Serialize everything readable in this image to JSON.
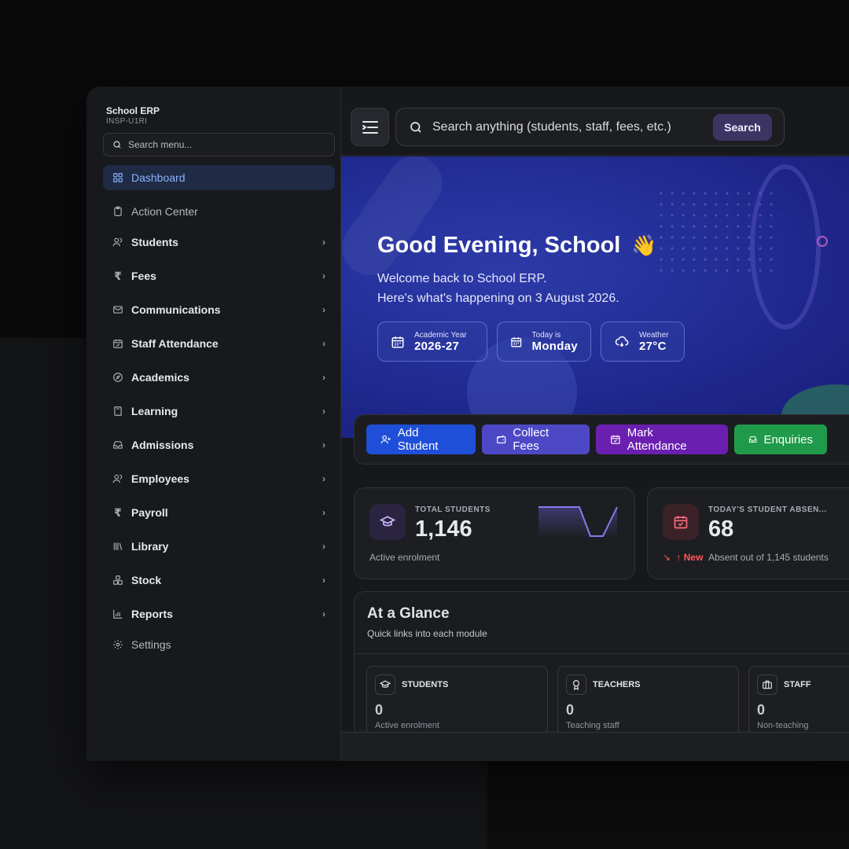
{
  "brand": {
    "title": "School ERP",
    "code": "INSP-U1RI"
  },
  "sidebar": {
    "search_placeholder": "Search menu...",
    "items": [
      {
        "label": "Dashboard",
        "icon": "grid-icon",
        "active": true
      },
      {
        "label": "Action Center",
        "icon": "clipboard-icon"
      },
      {
        "label": "Students",
        "icon": "users-icon"
      },
      {
        "label": "Fees",
        "icon": "rupee-icon"
      },
      {
        "label": "Communications",
        "icon": "mail-icon"
      },
      {
        "label": "Staff Attendance",
        "icon": "calendar-check-icon"
      },
      {
        "label": "Academics",
        "icon": "compass-icon"
      },
      {
        "label": "Learning",
        "icon": "book-icon"
      },
      {
        "label": "Admissions",
        "icon": "inbox-icon"
      },
      {
        "label": "Employees",
        "icon": "users-icon"
      },
      {
        "label": "Payroll",
        "icon": "rupee-icon"
      },
      {
        "label": "Library",
        "icon": "library-icon"
      },
      {
        "label": "Stock",
        "icon": "boxes-icon"
      },
      {
        "label": "Reports",
        "icon": "bar-chart-icon"
      },
      {
        "label": "Settings",
        "icon": "gear-icon"
      }
    ]
  },
  "topbar": {
    "search_placeholder": "Search anything (students, staff, fees, etc.)",
    "search_button": "Search"
  },
  "hero": {
    "greeting": "Good Evening, School",
    "wave": "👋",
    "line1": "Welcome back to School ERP.",
    "line2": "Here's what's happening on 3 August 2026.",
    "cards": [
      {
        "label": "Academic Year",
        "value": "2026-27"
      },
      {
        "label": "Today is",
        "value": "Monday"
      },
      {
        "label": "Weather",
        "value": "27°C"
      }
    ]
  },
  "actions": {
    "add_student": "Add Student",
    "collect_fees": "Collect Fees",
    "mark_attendance": "Mark Attendance",
    "enquiries": "Enquiries"
  },
  "stats": {
    "total_students": {
      "caption": "TOTAL STUDENTS",
      "value": "1,146",
      "footer": "Active enrolment"
    },
    "absent": {
      "caption": "TODAY'S STUDENT ABSEN...",
      "value": "68",
      "trend": "↑ New",
      "footer": "Absent out of 1,145 students"
    }
  },
  "glance": {
    "title": "At a Glance",
    "subtitle": "Quick links into each module",
    "cards": [
      {
        "label": "STUDENTS",
        "value": "0",
        "desc": "Active enrolment"
      },
      {
        "label": "TEACHERS",
        "value": "0",
        "desc": "Teaching staff"
      },
      {
        "label": "STAFF",
        "value": "0",
        "desc": "Non-teaching"
      }
    ]
  },
  "colors": {
    "accent": "#8ab4ff",
    "hero": "#24309a",
    "add": "#1f4fd8",
    "fees": "#4d49c6",
    "attendance": "#6a1fb0",
    "enquiries": "#1f9a4a"
  }
}
